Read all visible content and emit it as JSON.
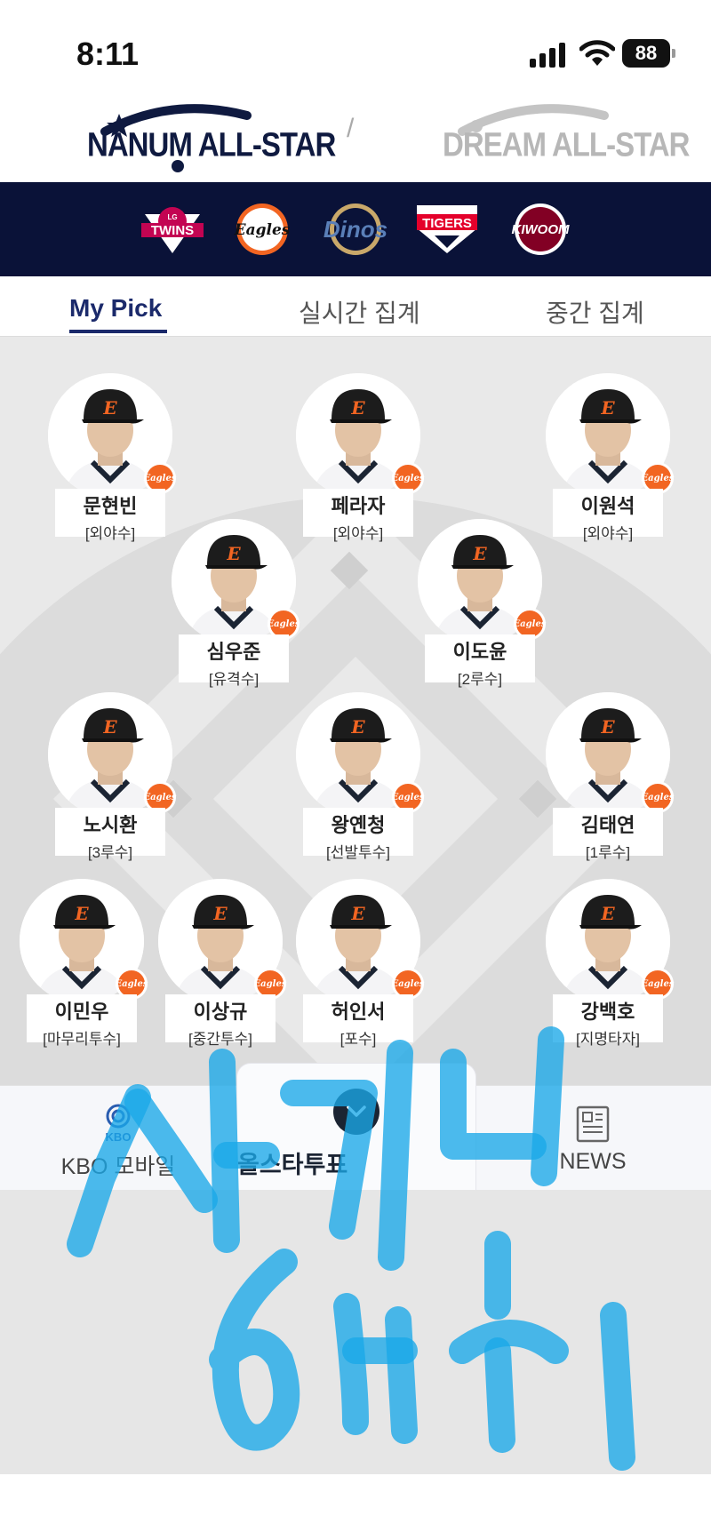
{
  "status": {
    "time": "8:11",
    "battery": "88"
  },
  "league": {
    "active": "NANUM ALL-STAR",
    "inactive": "DREAM ALL-STAR",
    "divider": "/"
  },
  "teams": [
    "TWINS",
    "Eagles",
    "Dinos",
    "TIGERS",
    "KIWOOM"
  ],
  "tabs": [
    "My Pick",
    "실시간 집계",
    "중간 집계"
  ],
  "badge": "Eagles",
  "players": [
    {
      "name": "문현빈",
      "pos": "[외야수]"
    },
    {
      "name": "페라자",
      "pos": "[외야수]"
    },
    {
      "name": "이원석",
      "pos": "[외야수]"
    },
    {
      "name": "심우준",
      "pos": "[유격수]"
    },
    {
      "name": "이도윤",
      "pos": "[2루수]"
    },
    {
      "name": "노시환",
      "pos": "[3루수]"
    },
    {
      "name": "왕옌청",
      "pos": "[선발투수]"
    },
    {
      "name": "김태연",
      "pos": "[1루수]"
    },
    {
      "name": "이민우",
      "pos": "[마무리투수]"
    },
    {
      "name": "이상규",
      "pos": "[중간투수]"
    },
    {
      "name": "허인서",
      "pos": "[포수]"
    },
    {
      "name": "강백호",
      "pos": "[지명타자]"
    }
  ],
  "nav": {
    "left": "KBO 모바일",
    "left_icon_text": "KBO",
    "center": "올스타투표",
    "right": "NEWS"
  },
  "colors": {
    "navy": "#0a1238",
    "accent": "#1b2a6b",
    "eagles_orange": "#f26522",
    "scribble": "#1aa8e8"
  }
}
